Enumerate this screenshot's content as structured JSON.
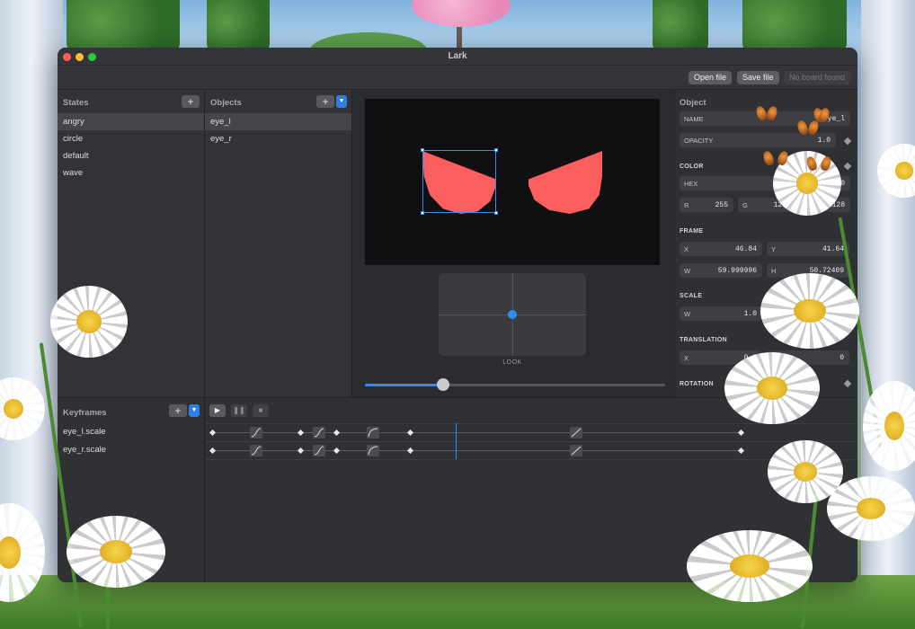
{
  "window": {
    "title": "Lark"
  },
  "toolbar": {
    "open_label": "Open file",
    "save_label": "Save file",
    "board_label": "No board found"
  },
  "states": {
    "title": "States",
    "add_label": "+",
    "items": [
      "angry",
      "circle",
      "default",
      "wave"
    ],
    "selected": "angry"
  },
  "objects": {
    "title": "Objects",
    "add_label": "+",
    "items": [
      "eye_l",
      "eye_r"
    ],
    "selected": "eye_l"
  },
  "canvas": {
    "eye_color": "#fa5e5e",
    "background": "#101012",
    "look_label": "LOOK",
    "slider_value": 0.26
  },
  "inspector": {
    "title": "Object",
    "name_label": "NAME",
    "name_value": "eye_l",
    "opacity_label": "OPACITY",
    "opacity_value": "1.0",
    "color_section": "COLOR",
    "hex_label": "HEX",
    "hex_value": "ff6080",
    "r_label": "R",
    "r_value": "255",
    "g_label": "G",
    "g_value": "128",
    "b_label": "B",
    "b_value": "128",
    "frame_section": "FRAME",
    "x_label": "X",
    "x_value": "46.84",
    "y_label": "Y",
    "y_value": "41.64",
    "w_label": "W",
    "w_value": "59.999996",
    "h_label": "H",
    "h_value": "50.72409",
    "scale_section": "SCALE",
    "scale_w_label": "W",
    "scale_w_value": "1.0",
    "translation_section": "TRANSLATION",
    "tx_label": "X",
    "tx_value": "0.0",
    "ty_value": "0",
    "rotation_section": "ROTATION"
  },
  "keyframes": {
    "title": "Keyframes",
    "add_label": "+",
    "play_icon": "play-icon",
    "pause_icon": "pause-icon",
    "stop_icon": "stop-icon",
    "tracks": [
      "eye_l.scale",
      "eye_r.scale"
    ]
  },
  "colors": {
    "accent": "#2e8cf0"
  }
}
